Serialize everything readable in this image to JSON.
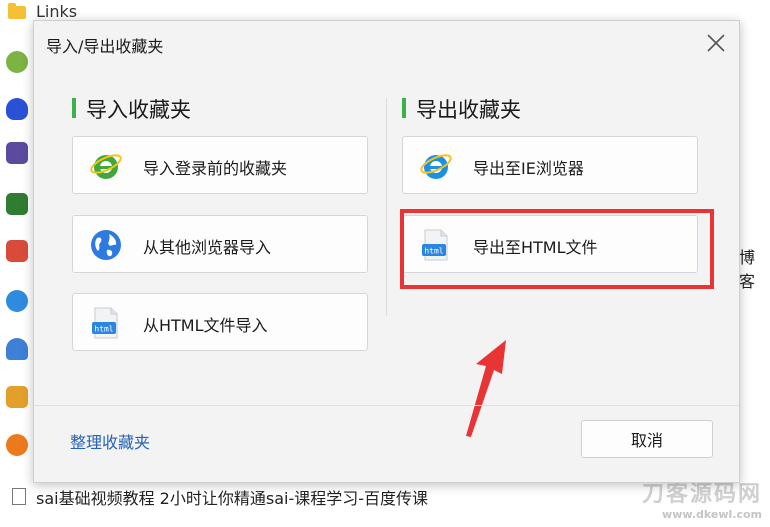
{
  "background": {
    "links_label": "Links",
    "side_text": "博客",
    "footer_text": "sai基础视频教程 2小时让你精通sai-课程学习-百度传课",
    "watermark_main": "刀客源码网",
    "watermark_sub": "www.dkewl.com"
  },
  "dialog": {
    "title": "导入/导出收藏夹",
    "import_section": {
      "title": "导入收藏夹",
      "buttons": [
        {
          "label": "导入登录前的收藏夹",
          "icon": "ie-green-icon"
        },
        {
          "label": "从其他浏览器导入",
          "icon": "globe-icon"
        },
        {
          "label": "从HTML文件导入",
          "icon": "html-file-icon",
          "icon_text": "html"
        }
      ]
    },
    "export_section": {
      "title": "导出收藏夹",
      "buttons": [
        {
          "label": "导出至IE浏览器",
          "icon": "ie-blue-icon"
        },
        {
          "label": "导出至HTML文件",
          "icon": "html-file-icon",
          "icon_text": "html"
        }
      ]
    },
    "manage_link": "整理收藏夹",
    "cancel_label": "取消"
  },
  "colors": {
    "accent_green": "#3cb04b",
    "highlight_red": "#e83434",
    "link_blue": "#2563b8"
  }
}
